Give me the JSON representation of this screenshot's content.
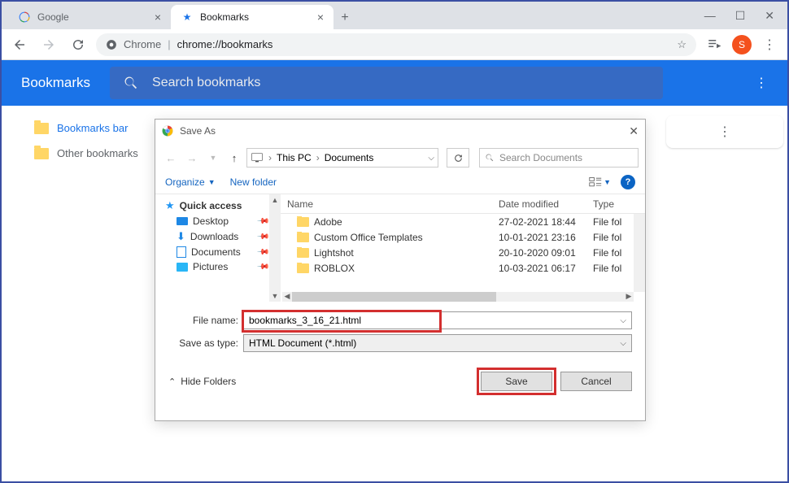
{
  "tabs": [
    {
      "label": "Google",
      "favicon": "google"
    },
    {
      "label": "Bookmarks",
      "favicon": "star"
    }
  ],
  "omnibox": {
    "prefix": "Chrome",
    "url": "chrome://bookmarks"
  },
  "avatar_initial": "S",
  "bookmarks": {
    "title": "Bookmarks",
    "search_placeholder": "Search bookmarks",
    "sidebar": [
      {
        "label": "Bookmarks bar"
      },
      {
        "label": "Other bookmarks"
      }
    ]
  },
  "dialog": {
    "title": "Save As",
    "breadcrumb": [
      "This PC",
      "Documents"
    ],
    "search_placeholder": "Search Documents",
    "toolbar": {
      "organize": "Organize",
      "new_folder": "New folder"
    },
    "tree": [
      {
        "label": "Quick access",
        "icon": "star"
      },
      {
        "label": "Desktop",
        "icon": "desktop",
        "pinned": true
      },
      {
        "label": "Downloads",
        "icon": "download",
        "pinned": true
      },
      {
        "label": "Documents",
        "icon": "document",
        "pinned": true
      },
      {
        "label": "Pictures",
        "icon": "pictures",
        "pinned": true
      }
    ],
    "columns": {
      "name": "Name",
      "date": "Date modified",
      "type": "Type"
    },
    "files": [
      {
        "name": "Adobe",
        "date": "27-02-2021 18:44",
        "type": "File fol"
      },
      {
        "name": "Custom Office Templates",
        "date": "10-01-2021 23:16",
        "type": "File fol"
      },
      {
        "name": "Lightshot",
        "date": "20-10-2020 09:01",
        "type": "File fol"
      },
      {
        "name": "ROBLOX",
        "date": "10-03-2021 06:17",
        "type": "File fol"
      }
    ],
    "file_name_label": "File name:",
    "file_name_value": "bookmarks_3_16_21.html",
    "save_type_label": "Save as type:",
    "save_type_value": "HTML Document (*.html)",
    "hide_folders": "Hide Folders",
    "save_btn": "Save",
    "cancel_btn": "Cancel"
  }
}
